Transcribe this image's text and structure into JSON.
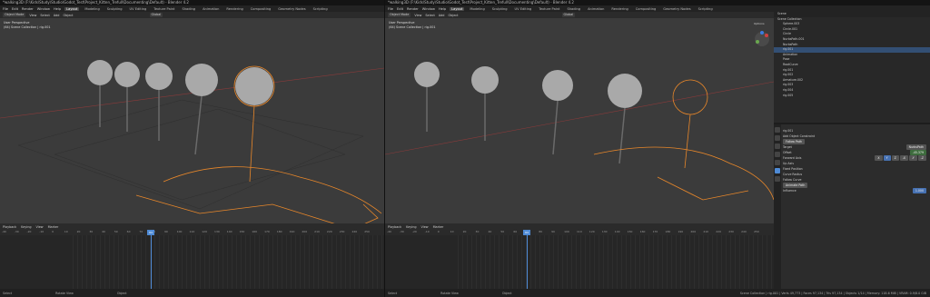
{
  "left": {
    "title": "*walking3D (F:\\Kids\\Study\\Studio\\Godot_Test\\Project_Kitten_Trefull\\Documenting\\Default) - Blender 4.2",
    "menus": [
      "File",
      "Edit",
      "Render",
      "Window",
      "Help"
    ],
    "workspaces": [
      "Layout",
      "Modeling",
      "Sculpting",
      "UV Editing",
      "Texture Paint",
      "Shading",
      "Animation",
      "Rendering",
      "Compositing",
      "Geometry Nodes",
      "Scripting"
    ],
    "active_workspace": "Layout",
    "header": {
      "mode": "Object Mode",
      "view": "View",
      "select": "Select",
      "add": "Add",
      "object": "Object",
      "orient": "Global"
    },
    "viewport_info": {
      "line1": "User Perspective",
      "line2": "(64) Scene Collection | rig.001"
    },
    "timeline": {
      "playback": "Playback",
      "keying": "Keying",
      "view": "View",
      "marker": "Marker"
    },
    "frame": "64",
    "status": {
      "left": "Select",
      "mid": "Rotate View",
      "right": "Object"
    }
  },
  "right": {
    "title": "*walking3D (F:\\Kids\\Study\\Studio\\Godot_Test\\Project_Kitten_Trefull\\Documenting\\Default) - Blender 4.2",
    "menus": [
      "File",
      "Edit",
      "Render",
      "Window",
      "Help"
    ],
    "workspaces": [
      "Layout",
      "Modeling",
      "Sculpting",
      "UV Editing",
      "Texture Paint",
      "Shading",
      "Animation",
      "Rendering",
      "Compositing",
      "Geometry Nodes",
      "Scripting"
    ],
    "active_workspace": "Layout",
    "header": {
      "mode": "Object Mode",
      "view": "View",
      "select": "Select",
      "add": "Add",
      "object": "Object",
      "orient": "Global"
    },
    "viewport_info": {
      "line1": "User Perspective",
      "line2": "(64) Scene Collection | rig.001"
    },
    "timeline": {
      "playback": "Playback",
      "keying": "Keying",
      "view": "View",
      "marker": "Marker"
    },
    "frame": "64",
    "status": {
      "left": "Select",
      "mid": "Rotate View",
      "right": "Object",
      "stats": "Scene Collection | rig.001 | Verts 49,773 | Faces 97,134 | Tris 97,134 | Objects 1/14 | Memory: 118.6 MiB | VRAM: 0.9/8.0 GiB"
    }
  },
  "ruler_ticks": [
    "-40",
    "-30",
    "-20",
    "-10",
    "0",
    "10",
    "20",
    "30",
    "40",
    "50",
    "60",
    "70",
    "80",
    "90",
    "100",
    "110",
    "120",
    "130",
    "140",
    "150",
    "160",
    "170",
    "180",
    "190",
    "200",
    "210",
    "220",
    "230",
    "240",
    "250"
  ],
  "outliner": {
    "search": "Scene",
    "rows": [
      "Scene Collection",
      "Sphere.003",
      "Circle.001",
      "Circle",
      "NurbsPath.001",
      "NurbsPath",
      "rig.001",
      "Animation",
      "Pose",
      "RootCurve",
      "rig.001",
      "rig.002",
      "Armature.002",
      "rig.003",
      "rig.004",
      "rig.005"
    ],
    "selected_index": 6
  },
  "properties": {
    "object": "rig.001",
    "section": "Add Object Constraint",
    "constraint": "Follow Path",
    "target_label": "Target",
    "target": "NurbsPath",
    "offset_label": "Offset",
    "offset": "-45.379",
    "forward_label": "Forward Axis",
    "axes": [
      "X",
      "Y",
      "Z",
      "-X",
      "-Y",
      "-Z"
    ],
    "up_label": "Up Axis",
    "fixed": "Fixed Position",
    "curve_radius": "Curve Radius",
    "follow_curve": "Follow Curve",
    "animate": "Animate Path",
    "influence_label": "Influence",
    "influence": "1.000"
  },
  "viewport_right_header": {
    "options": "Options",
    "view": "View",
    "select": "Select",
    "add": "Add"
  },
  "colors": {
    "accent": "#4f8bd6",
    "selection_orange": "#e8872a",
    "bg": "#3b3b3b"
  }
}
